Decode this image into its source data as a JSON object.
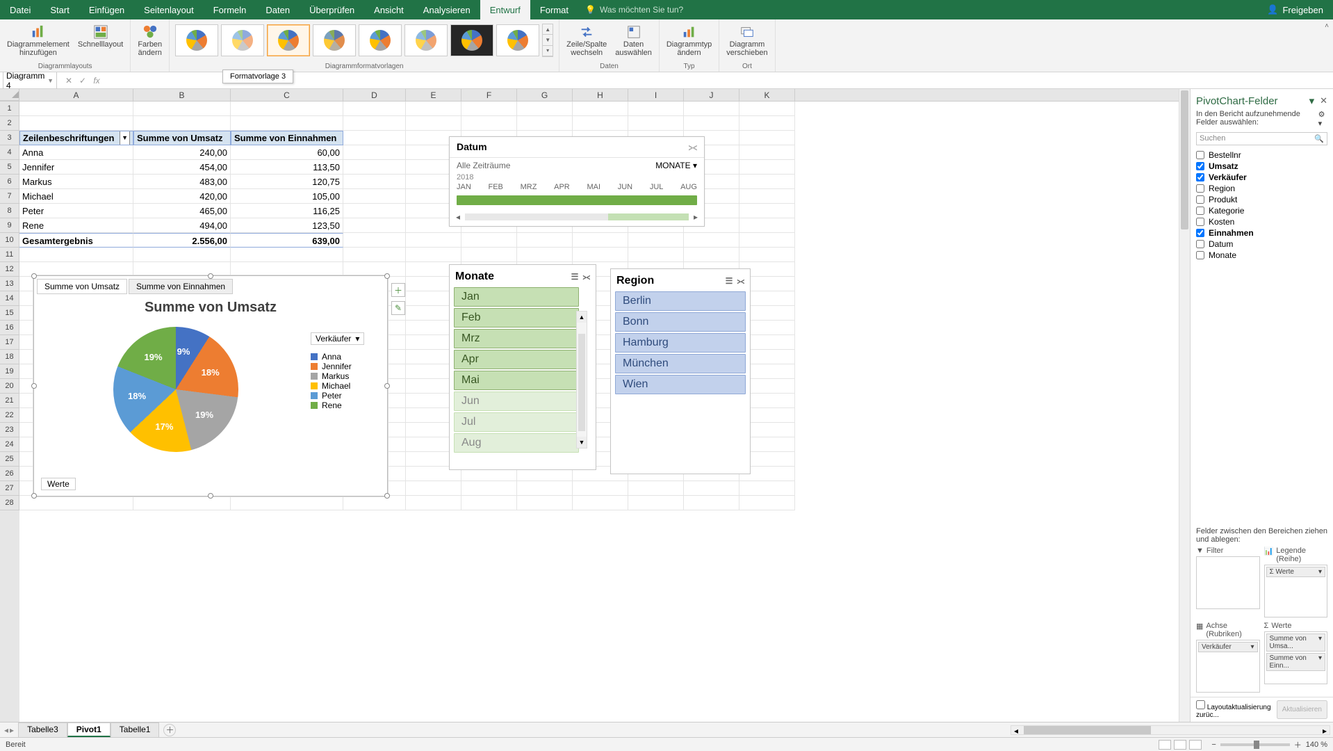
{
  "titlebar": {
    "tabs": [
      "Datei",
      "Start",
      "Einfügen",
      "Seitenlayout",
      "Formeln",
      "Daten",
      "Überprüfen",
      "Ansicht",
      "Analysieren",
      "Entwurf",
      "Format"
    ],
    "active_index": 9,
    "tell_me": "Was möchten Sie tun?",
    "share": "Freigeben"
  },
  "ribbon": {
    "add_element": "Diagrammelement\nhinzufügen",
    "quick_layout": "Schnelllayout",
    "layouts_group": "Diagrammlayouts",
    "change_colors": "Farben\nändern",
    "styles_group": "Diagrammformatvorlagen",
    "tooltip": "Formatvorlage 3",
    "switch_rc": "Zeile/Spalte\nwechseln",
    "select_data": "Daten\nauswählen",
    "data_group": "Daten",
    "change_type": "Diagrammtyp\nändern",
    "type_group": "Typ",
    "move_chart": "Diagramm\nverschieben",
    "location_group": "Ort"
  },
  "namebox": "Diagramm 4",
  "columns": [
    "A",
    "B",
    "C",
    "D",
    "E",
    "F",
    "G",
    "H",
    "I",
    "J",
    "K"
  ],
  "row_count": 28,
  "pivot": {
    "row_label_hdr": "Zeilenbeschriftungen",
    "col_b_hdr": "Summe von Umsatz",
    "col_c_hdr": "Summe von Einnahmen",
    "rows": [
      {
        "name": "Anna",
        "b": "240,00",
        "c": "60,00"
      },
      {
        "name": "Jennifer",
        "b": "454,00",
        "c": "113,50"
      },
      {
        "name": "Markus",
        "b": "483,00",
        "c": "120,75"
      },
      {
        "name": "Michael",
        "b": "420,00",
        "c": "105,00"
      },
      {
        "name": "Peter",
        "b": "465,00",
        "c": "116,25"
      },
      {
        "name": "Rene",
        "b": "494,00",
        "c": "123,50"
      }
    ],
    "total_label": "Gesamtergebnis",
    "total_b": "2.556,00",
    "total_c": "639,00"
  },
  "timeline": {
    "title": "Datum",
    "range_text": "Alle Zeiträume",
    "level": "MONATE",
    "year": "2018",
    "months": [
      "JAN",
      "FEB",
      "MRZ",
      "APR",
      "MAI",
      "JUN",
      "JUL",
      "AUG"
    ]
  },
  "slicer_monate": {
    "title": "Monate",
    "items": [
      {
        "label": "Jan",
        "dim": false
      },
      {
        "label": "Feb",
        "dim": false
      },
      {
        "label": "Mrz",
        "dim": false
      },
      {
        "label": "Apr",
        "dim": false
      },
      {
        "label": "Mai",
        "dim": false
      },
      {
        "label": "Jun",
        "dim": true
      },
      {
        "label": "Jul",
        "dim": true
      },
      {
        "label": "Aug",
        "dim": true
      }
    ]
  },
  "slicer_region": {
    "title": "Region",
    "items": [
      "Berlin",
      "Bonn",
      "Hamburg",
      "München",
      "Wien"
    ]
  },
  "chart": {
    "tabs": [
      "Summe von Umsatz",
      "Summe von Einnahmen"
    ],
    "active_tab": 0,
    "title": "Summe von Umsatz",
    "legend_filter": "Verkäufer",
    "legend": [
      {
        "name": "Anna",
        "color": "#4472c4"
      },
      {
        "name": "Jennifer",
        "color": "#ed7d31"
      },
      {
        "name": "Markus",
        "color": "#a5a5a5"
      },
      {
        "name": "Michael",
        "color": "#ffc000"
      },
      {
        "name": "Peter",
        "color": "#5b9bd5"
      },
      {
        "name": "Rene",
        "color": "#70ad47"
      }
    ],
    "footer": "Werte"
  },
  "chart_data": {
    "type": "pie",
    "title": "Summe von Umsatz",
    "series_field": "Verkäufer",
    "slices": [
      {
        "name": "Anna",
        "value": 240.0,
        "pct": 9,
        "color": "#4472c4"
      },
      {
        "name": "Jennifer",
        "value": 454.0,
        "pct": 18,
        "color": "#ed7d31"
      },
      {
        "name": "Markus",
        "value": 483.0,
        "pct": 19,
        "color": "#a5a5a5"
      },
      {
        "name": "Michael",
        "value": 420.0,
        "pct": 17,
        "color": "#ffc000"
      },
      {
        "name": "Peter",
        "value": 465.0,
        "pct": 18,
        "color": "#5b9bd5"
      },
      {
        "name": "Rene",
        "value": 494.0,
        "pct": 19,
        "color": "#70ad47"
      }
    ],
    "data_labels": "percentage",
    "legend_position": "right"
  },
  "field_panel": {
    "title": "PivotChart-Felder",
    "subtitle": "In den Bericht aufzunehmende Felder auswählen:",
    "search": "Suchen",
    "fields": [
      {
        "name": "Bestellnr",
        "checked": false
      },
      {
        "name": "Umsatz",
        "checked": true
      },
      {
        "name": "Verkäufer",
        "checked": true
      },
      {
        "name": "Region",
        "checked": false
      },
      {
        "name": "Produkt",
        "checked": false
      },
      {
        "name": "Kategorie",
        "checked": false
      },
      {
        "name": "Kosten",
        "checked": false
      },
      {
        "name": "Einnahmen",
        "checked": true
      },
      {
        "name": "Datum",
        "checked": false
      },
      {
        "name": "Monate",
        "checked": false
      }
    ],
    "areas_hdr": "Felder zwischen den Bereichen ziehen und ablegen:",
    "area_filter": "Filter",
    "area_legend": "Legende (Reihe)",
    "area_axis": "Achse (Rubriken)",
    "area_values": "Werte",
    "legend_pill": "Werte",
    "axis_pill": "Verkäufer",
    "value_pill1": "Summe von Umsa...",
    "value_pill2": "Summe von Einn...",
    "defer": "Layoutaktualisierung zurüc...",
    "update": "Aktualisieren"
  },
  "sheettabs": {
    "tabs": [
      "Tabelle3",
      "Pivot1",
      "Tabelle1"
    ],
    "active_index": 1
  },
  "statusbar": {
    "ready": "Bereit",
    "zoom": "140 %"
  }
}
